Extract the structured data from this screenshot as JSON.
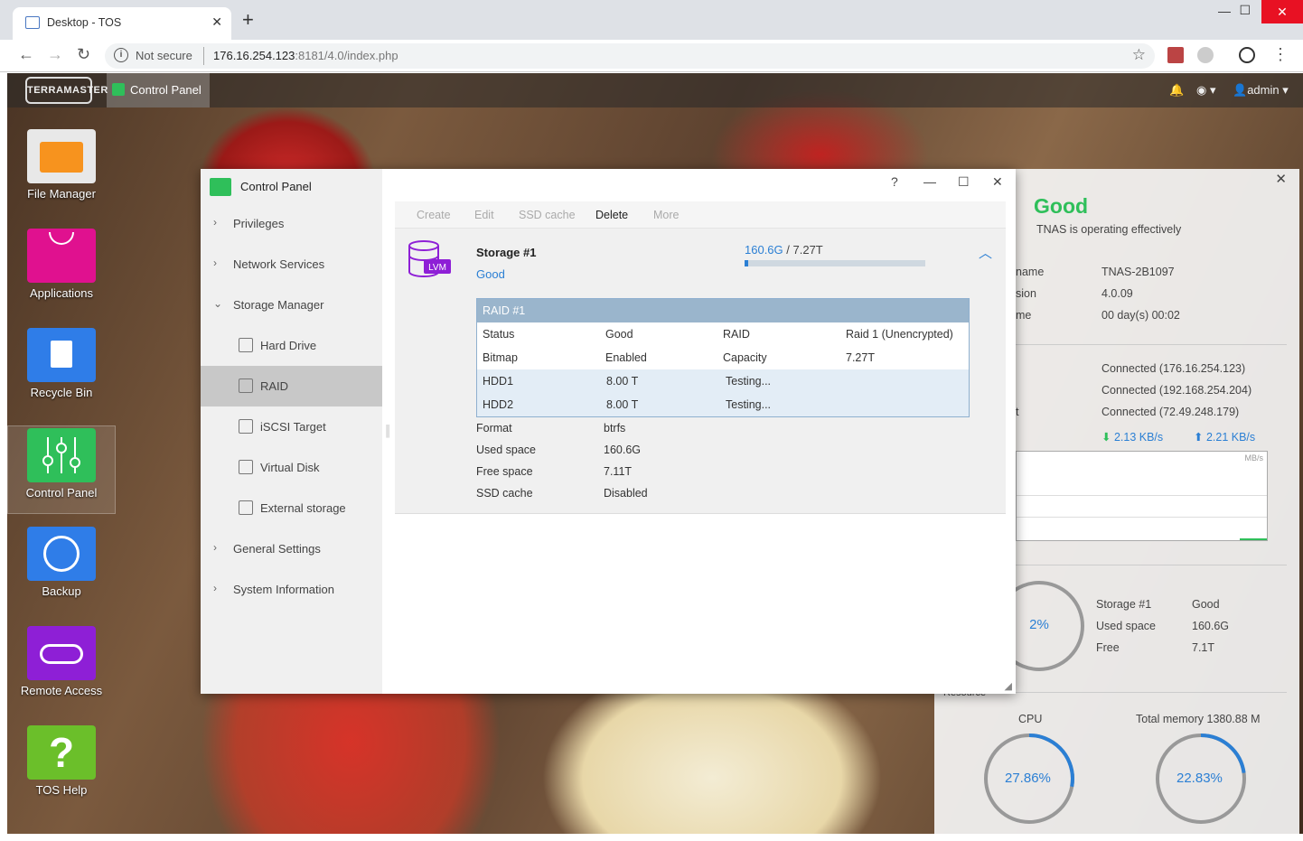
{
  "browser": {
    "tab_title": "Desktop - TOS",
    "new_tab": "+",
    "security": "Not secure",
    "url_host": "176.16.254.123",
    "url_rest": ":8181/4.0/index.php"
  },
  "topbar": {
    "logo": "TERRAMASTER",
    "active_app": "Control Panel",
    "user": "admin"
  },
  "desktop_icons": [
    {
      "label": "File Manager"
    },
    {
      "label": "Applications"
    },
    {
      "label": "Recycle Bin"
    },
    {
      "label": "Control Panel"
    },
    {
      "label": "Backup"
    },
    {
      "label": "Remote Access"
    },
    {
      "label": "TOS Help"
    }
  ],
  "control_panel": {
    "title": "Control Panel",
    "window_help": "?",
    "nav": [
      {
        "label": "Privileges"
      },
      {
        "label": "Network Services"
      },
      {
        "label": "Storage Manager"
      },
      {
        "label": "Hard Drive"
      },
      {
        "label": "RAID"
      },
      {
        "label": "iSCSI Target"
      },
      {
        "label": "Virtual Disk"
      },
      {
        "label": "External storage"
      },
      {
        "label": "General Settings"
      },
      {
        "label": "System Information"
      }
    ],
    "toolbar": {
      "create": "Create",
      "edit": "Edit",
      "ssd_cache": "SSD cache",
      "delete": "Delete",
      "more": "More"
    },
    "storage": {
      "badge": "LVM",
      "name": "Storage #1",
      "status": "Good",
      "used": "160.6G",
      "total": "/ 7.27T",
      "used_fraction": 0.022,
      "raid": {
        "title": "RAID #1",
        "rows": [
          [
            "Status",
            "Good",
            "RAID",
            "Raid 1 (Unencrypted)"
          ],
          [
            "Bitmap",
            "Enabled",
            "Capacity",
            "7.27T"
          ],
          [
            "HDD1",
            "8.00 T",
            "Testing...",
            ""
          ],
          [
            "HDD2",
            "8.00 T",
            "Testing...",
            ""
          ]
        ]
      },
      "details": [
        [
          "Format",
          "btrfs"
        ],
        [
          "Used space",
          "160.6G"
        ],
        [
          "Free space",
          "7.11T"
        ],
        [
          "SSD cache",
          "Disabled"
        ]
      ]
    }
  },
  "widget": {
    "health": "Good",
    "health_desc": "TNAS is operating effectively",
    "info_labels": [
      "name",
      "sion",
      "me"
    ],
    "info_values": [
      "TNAS-2B1097",
      "4.0.09",
      "00 day(s) 00:02"
    ],
    "net_label": "t",
    "network": [
      "Connected (176.16.254.123)",
      "Connected (192.168.254.204)",
      "Connected (72.49.248.179)"
    ],
    "download": "2.13 KB/s",
    "upload": "2.21 KB/s",
    "chart_unit": "MB/s",
    "storage_pct": "2%",
    "storage_rows": [
      [
        "Storage #1",
        "Good"
      ],
      [
        "Used space",
        "160.6G"
      ],
      [
        "Free",
        "7.1T"
      ]
    ],
    "resource_label": "Resource",
    "cpu_label": "CPU",
    "cpu_pct": "27.86%",
    "cpu_fraction": 0.2786,
    "mem_label": "Total memory 1380.88 M",
    "mem_pct": "22.83%",
    "mem_fraction": 0.2283
  },
  "colors": {
    "accent": "#2b7fd4",
    "good": "#2fbf5a"
  }
}
